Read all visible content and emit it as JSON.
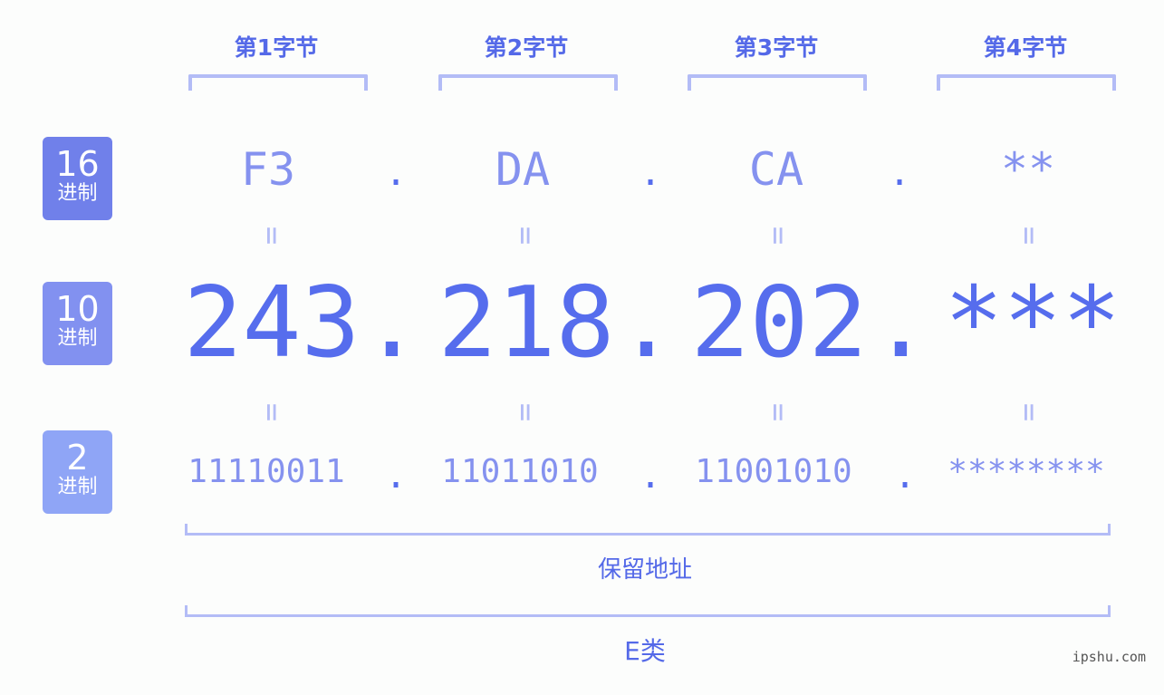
{
  "byte_headers": [
    "第1字节",
    "第2字节",
    "第3字节",
    "第4字节"
  ],
  "badges": [
    {
      "num": "16",
      "unit": "进制",
      "color": "#7080ea"
    },
    {
      "num": "10",
      "unit": "进制",
      "color": "#8291f0"
    },
    {
      "num": "2",
      "unit": "进制",
      "color": "#8fa5f6"
    }
  ],
  "hex": [
    "F3",
    "DA",
    "CA",
    "**"
  ],
  "dec": [
    "243",
    "218",
    "202",
    "***"
  ],
  "bin": [
    "11110011",
    "11011010",
    "11001010",
    "********"
  ],
  "separator": ".",
  "equals": "=",
  "ranges": [
    {
      "label": "保留地址"
    },
    {
      "label": "E类"
    }
  ],
  "watermark": "ipshu.com",
  "colors": {
    "accent": "#566ded",
    "light": "#8592ef",
    "bracket": "#b3bcf6"
  }
}
